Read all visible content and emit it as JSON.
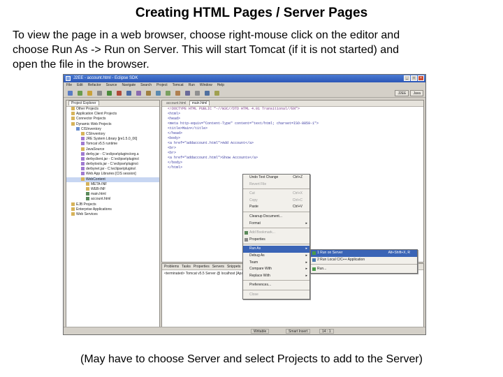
{
  "slide": {
    "title": "Creating HTML Pages / Server Pages",
    "line1": "To view the page in a web browser, choose right-mouse click on the editor and",
    "line2": "choose Run As -> Run on Server.  This will start Tomcat (if it is not started) and",
    "line3": "open the file in the browser.",
    "footer": "(May have to choose Server and select Projects to add to the Server)"
  },
  "window": {
    "title": "J2EE - account.html - Eclipse SDK",
    "menus": [
      "File",
      "Edit",
      "Refactor",
      "Source",
      "Navigate",
      "Search",
      "Project",
      "Tomcat",
      "Run",
      "Window",
      "Help"
    ],
    "perspectives": [
      "J2EE",
      "Java"
    ]
  },
  "explorer": {
    "tab": "Project Explorer",
    "items": [
      "Other Projects",
      "Application Client Projects",
      "Connector Projects",
      "Dynamic Web Projects",
      "CISInventory",
      "CSInventory",
      "JRE System Library [jre1.5.0_06]",
      "Tomcat v5.5 runtime",
      "JavaSource",
      "derby.jar - C:\\eclipse\\plugins\\org.a",
      "derbyclient.jar - C:\\eclipse\\plugins\\",
      "derbytools.jar - C:\\eclipse\\plugins\\",
      "derbynet.jar - C:\\eclipse\\plugins\\",
      "Web App Libraries [CIS session]",
      "WebContent",
      "META-INF",
      "WEB-INF",
      "main.html",
      "account.html",
      "EJB Projects",
      "Enterprise Applications",
      "Web Services"
    ]
  },
  "editor": {
    "tabs": [
      "account.html",
      "main.html"
    ],
    "lines": [
      "<!DOCTYPE HTML PUBLIC \"-//W3C//DTD HTML 4.01 Transitional//EN\">",
      "<html>",
      "<head>",
      "<meta http-equiv=\"Content-Type\" content=\"text/html; charset=ISO-8859-1\">",
      "<title>Main</title>",
      "</head>",
      "<body>",
      "<a href=\"addaccount.html\">Add Account</a>",
      "<br>",
      "<br>",
      "<a href=\"addaccount.html\">Show Accounts</a>",
      "</body>",
      "</html>"
    ]
  },
  "bottom_panel": {
    "tabs": [
      "Problems",
      "Tasks",
      "Properties",
      "Servers",
      "Snippets",
      "Console"
    ],
    "console_line": "<terminated> Tomcat v5.5 Server @ localhost [Apache Tomcat] ..."
  },
  "statusbar": {
    "writable": "Writable",
    "insert_mode": "Smart Insert",
    "position": "14 : 1"
  },
  "context_menu": {
    "items": [
      {
        "label": "Undo Text Change",
        "shortcut": "Ctrl+Z"
      },
      {
        "label": "Revert File",
        "shortcut": ""
      },
      {
        "label": "sep"
      },
      {
        "label": "Cut",
        "shortcut": "Ctrl+X"
      },
      {
        "label": "Copy",
        "shortcut": "Ctrl+C"
      },
      {
        "label": "Paste",
        "shortcut": "Ctrl+V"
      },
      {
        "label": "sep"
      },
      {
        "label": "Cleanup Document...",
        "shortcut": ""
      },
      {
        "label": "Format",
        "shortcut": ""
      },
      {
        "label": "sep"
      },
      {
        "label": "Add Bookmark...",
        "shortcut": ""
      },
      {
        "label": "Properties",
        "shortcut": ""
      },
      {
        "label": "sep"
      },
      {
        "label": "Run As",
        "shortcut": ""
      },
      {
        "label": "Debug As",
        "shortcut": ""
      },
      {
        "label": "Team",
        "shortcut": ""
      },
      {
        "label": "Compare With",
        "shortcut": ""
      },
      {
        "label": "Replace With",
        "shortcut": ""
      },
      {
        "label": "sep"
      },
      {
        "label": "Preferences...",
        "shortcut": ""
      },
      {
        "label": "sep"
      },
      {
        "label": "Close",
        "shortcut": ""
      }
    ]
  },
  "submenu": {
    "items": [
      {
        "label": "1 Run on Server",
        "shortcut": "Alt+Shift+X, R"
      },
      {
        "label": "2 Run Local C/C++ Application",
        "shortcut": ""
      },
      {
        "label": "sep"
      },
      {
        "label": "Run...",
        "shortcut": ""
      }
    ]
  }
}
